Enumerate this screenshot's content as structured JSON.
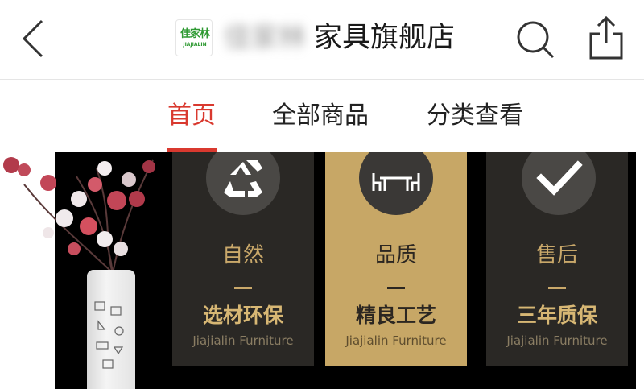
{
  "header": {
    "logo": {
      "cn": "佳家林",
      "en": "JIAJIALIN"
    },
    "store_name_blurred": "佳家林",
    "store_name": "家具旗舰店"
  },
  "tabs": [
    {
      "label": "首页",
      "active": true
    },
    {
      "label": "全部商品",
      "active": false
    },
    {
      "label": "分类查看",
      "active": false
    }
  ],
  "colors": {
    "accent": "#d9392f",
    "gold": "#c7a766",
    "card_dark": "#2a2825"
  },
  "banner": {
    "cards": [
      {
        "icon": "recycle-icon",
        "title": "自然",
        "subtitle": "选材环保",
        "en": "Jiajialin Furniture",
        "style": "dark"
      },
      {
        "icon": "table-icon",
        "title": "品质",
        "subtitle": "精良工艺",
        "en": "Jiajialin Furniture",
        "style": "gold"
      },
      {
        "icon": "checkmark-icon",
        "title": "售后",
        "subtitle": "三年质保",
        "en": "Jiajialin Furniture",
        "style": "dark"
      }
    ]
  }
}
